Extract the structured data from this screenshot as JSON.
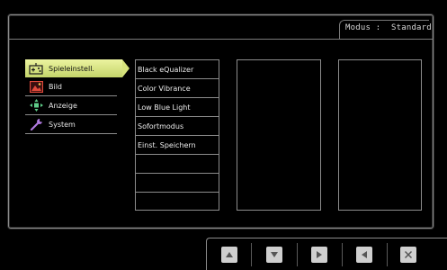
{
  "header": {
    "mode_label": "Modus",
    "mode_separator": ":",
    "mode_value": "Standard"
  },
  "menu": {
    "items": [
      {
        "label": "Spieleinstell.",
        "icon": "gamepad-icon",
        "selected": true
      },
      {
        "label": "Bild",
        "icon": "picture-icon",
        "selected": false
      },
      {
        "label": "Anzeige",
        "icon": "display-arrows-icon",
        "selected": false
      },
      {
        "label": "System",
        "icon": "wrench-icon",
        "selected": false
      }
    ]
  },
  "submenu": {
    "items": [
      {
        "label": "Black eQualizer"
      },
      {
        "label": "Color Vibrance"
      },
      {
        "label": "Low Blue Light"
      },
      {
        "label": "Sofortmodus"
      },
      {
        "label": "Einst. Speichern"
      },
      {
        "label": ""
      },
      {
        "label": ""
      },
      {
        "label": ""
      }
    ]
  },
  "nav_buttons": [
    {
      "name": "up-button",
      "icon": "triangle-up-icon"
    },
    {
      "name": "down-button",
      "icon": "triangle-down-icon"
    },
    {
      "name": "right-button",
      "icon": "triangle-right-icon"
    },
    {
      "name": "left-button",
      "icon": "triangle-left-icon"
    },
    {
      "name": "close-button",
      "icon": "close-icon"
    }
  ],
  "colors": {
    "selected_highlight": "#d6e27c",
    "frame": "#8c8c8c",
    "background": "#000000",
    "button": "#cfcfcf"
  }
}
